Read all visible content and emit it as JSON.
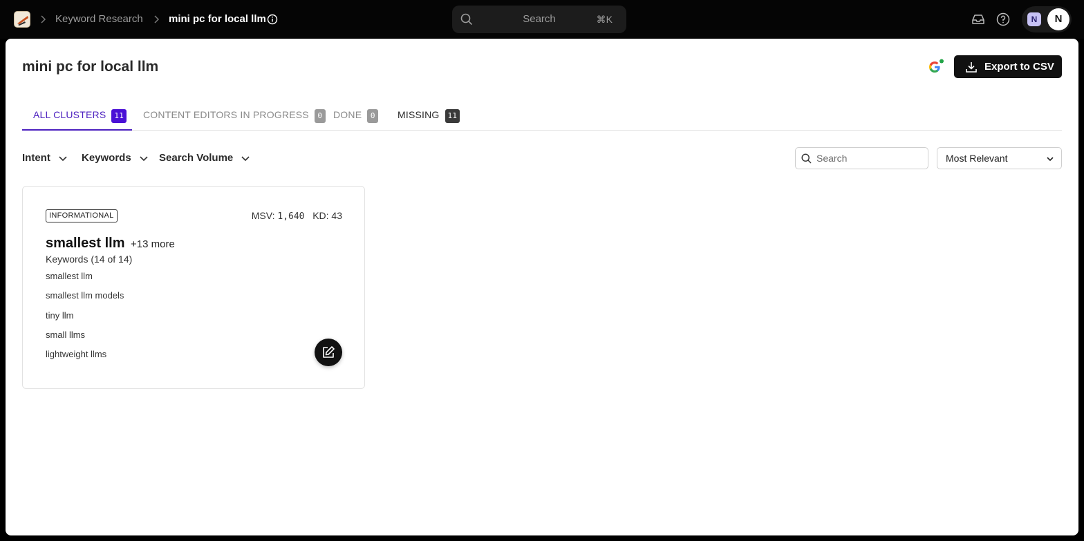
{
  "breadcrumb": {
    "parent": "Keyword Research",
    "current": "mini pc for local llm"
  },
  "global_search": {
    "label": "Search",
    "shortcut": "⌘K"
  },
  "user": {
    "workspace_initial": "N",
    "avatar_initial": "N"
  },
  "page": {
    "title": "mini pc for local llm",
    "export_label": "Export to CSV"
  },
  "tabs": [
    {
      "label": "ALL CLUSTERS",
      "count": "11"
    },
    {
      "label": "CONTENT EDITORS IN PROGRESS",
      "count": "0"
    },
    {
      "label": "DONE",
      "count": "0"
    },
    {
      "label": "MISSING",
      "count": "11"
    }
  ],
  "filters": {
    "intent": "Intent",
    "keywords": "Keywords",
    "search_volume": "Search Volume"
  },
  "list_search": {
    "placeholder": "Search"
  },
  "sort": {
    "selected": "Most Relevant"
  },
  "clusters": [
    {
      "intent": "INFORMATIONAL",
      "msv_label": "MSV:",
      "msv": "1,640",
      "kd_label": "KD:",
      "kd": "43",
      "title": "smallest llm",
      "more": "+13 more",
      "keyword_count": "Keywords (14 of 14)",
      "keywords": [
        "smallest llm",
        "smallest llm models",
        "tiny llm",
        "small llms",
        "lightweight llms"
      ]
    }
  ],
  "colors": {
    "accent": "#4a10d6",
    "topbar": "#050505"
  }
}
